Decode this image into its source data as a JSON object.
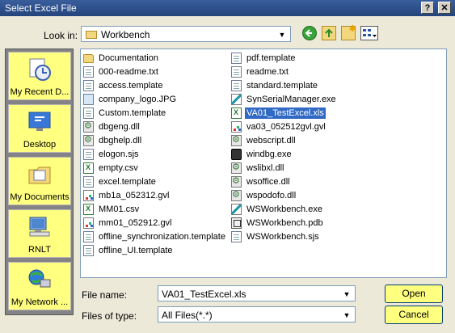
{
  "window": {
    "title": "Select Excel File",
    "help_glyph": "?",
    "close_glyph": "✕"
  },
  "lookin": {
    "label": "Look in:",
    "value": "Workbench",
    "icon": "folder-icon"
  },
  "toolbar": {
    "buttons": [
      "back-icon",
      "up-folder-icon",
      "new-folder-icon",
      "views-menu-icon"
    ]
  },
  "places": [
    {
      "label": "My Recent D...",
      "icon": "recent-documents-icon"
    },
    {
      "label": "Desktop",
      "icon": "desktop-icon"
    },
    {
      "label": "My Documents",
      "icon": "my-documents-icon"
    },
    {
      "label": "RNLT",
      "icon": "computer-icon"
    },
    {
      "label": "My Network ...",
      "icon": "network-icon"
    }
  ],
  "files": {
    "column1": [
      {
        "name": "Documentation",
        "icon": "folder"
      },
      {
        "name": "000-readme.txt",
        "icon": "doc"
      },
      {
        "name": "access.template",
        "icon": "doc"
      },
      {
        "name": "company_logo.JPG",
        "icon": "img"
      },
      {
        "name": "Custom.template",
        "icon": "doc"
      },
      {
        "name": "dbgeng.dll",
        "icon": "gear"
      },
      {
        "name": "dbghelp.dll",
        "icon": "gear"
      },
      {
        "name": "elogon.sjs",
        "icon": "doc"
      },
      {
        "name": "empty.csv",
        "icon": "excel"
      },
      {
        "name": "excel.template",
        "icon": "doc"
      },
      {
        "name": "mb1a_052312.gvl",
        "icon": "gvl"
      },
      {
        "name": "MM01.csv",
        "icon": "excel"
      },
      {
        "name": "mm01_052912.gvl",
        "icon": "gvl"
      },
      {
        "name": "offline_synchronization.template",
        "icon": "doc"
      },
      {
        "name": "offline_UI.template",
        "icon": "doc"
      }
    ],
    "column2": [
      {
        "name": "pdf.template",
        "icon": "doc"
      },
      {
        "name": "readme.txt",
        "icon": "doc"
      },
      {
        "name": "standard.template",
        "icon": "doc"
      },
      {
        "name": "SynSerialManager.exe",
        "icon": "syn"
      },
      {
        "name": "VA01_TestExcel.xls",
        "icon": "excel",
        "selected": true
      },
      {
        "name": "va03_052512gvl.gvl",
        "icon": "gvl"
      },
      {
        "name": "webscript.dll",
        "icon": "gear"
      },
      {
        "name": "windbg.exe",
        "icon": "wind"
      },
      {
        "name": "wslibxl.dll",
        "icon": "gear"
      },
      {
        "name": "wsoffice.dll",
        "icon": "gear"
      },
      {
        "name": "wspodofo.dll",
        "icon": "gear"
      },
      {
        "name": "WSWorkbench.exe",
        "icon": "syn"
      },
      {
        "name": "WSWorkbench.pdb",
        "icon": "pdb"
      },
      {
        "name": "WSWorkbench.sjs",
        "icon": "doc"
      }
    ]
  },
  "filename": {
    "label": "File name:",
    "value": "VA01_TestExcel.xls"
  },
  "filetype": {
    "label": "Files of type:",
    "value": "All Files(*.*)"
  },
  "buttons": {
    "open": "Open",
    "cancel": "Cancel"
  }
}
